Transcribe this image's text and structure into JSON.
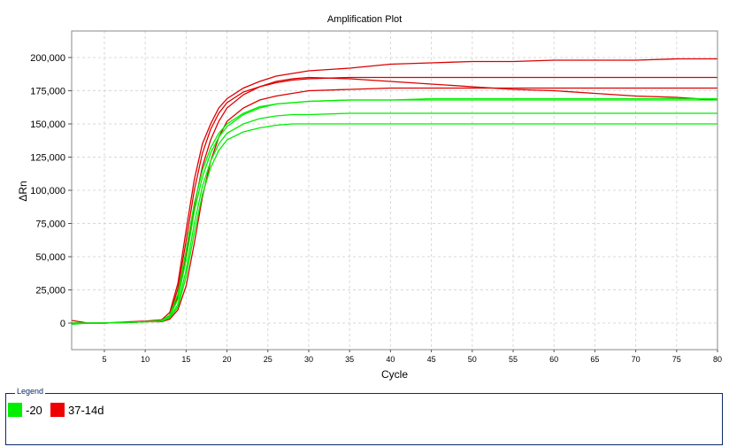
{
  "chart_data": {
    "type": "line",
    "title": "Amplification Plot",
    "xlabel": "Cycle",
    "ylabel": "ΔRn",
    "xlim": [
      1,
      80
    ],
    "ylim": [
      -20000,
      220000
    ],
    "xticks": [
      5,
      10,
      15,
      20,
      25,
      30,
      35,
      40,
      45,
      50,
      55,
      60,
      65,
      70,
      75,
      80
    ],
    "yticks": [
      0,
      25000,
      50000,
      75000,
      100000,
      125000,
      150000,
      175000,
      200000
    ],
    "ytick_labels": [
      "0",
      "25,000",
      "50,000",
      "75,000",
      "100,000",
      "125,000",
      "150,000",
      "175,000",
      "200,000"
    ],
    "grid": true,
    "legend_position": "bottom",
    "series": [
      {
        "name": "37-14d",
        "color": "#dd0000",
        "points": [
          [
            1,
            2000
          ],
          [
            3,
            0
          ],
          [
            5,
            0
          ],
          [
            8,
            1000
          ],
          [
            10,
            1500
          ],
          [
            12,
            2500
          ],
          [
            13,
            8000
          ],
          [
            14,
            30000
          ],
          [
            15,
            70000
          ],
          [
            16,
            108000
          ],
          [
            17,
            135000
          ],
          [
            18,
            150000
          ],
          [
            19,
            162000
          ],
          [
            20,
            169000
          ],
          [
            22,
            177000
          ],
          [
            24,
            182000
          ],
          [
            26,
            186000
          ],
          [
            28,
            188000
          ],
          [
            30,
            190000
          ],
          [
            35,
            192000
          ],
          [
            40,
            195000
          ],
          [
            45,
            196000
          ],
          [
            50,
            197000
          ],
          [
            55,
            197000
          ],
          [
            60,
            198000
          ],
          [
            65,
            198000
          ],
          [
            70,
            198000
          ],
          [
            75,
            199000
          ],
          [
            80,
            199000
          ]
        ]
      },
      {
        "name": "37-14d",
        "color": "#dd0000",
        "points": [
          [
            1,
            -500
          ],
          [
            3,
            0
          ],
          [
            5,
            0
          ],
          [
            8,
            500
          ],
          [
            10,
            1000
          ],
          [
            12,
            1500
          ],
          [
            13,
            6000
          ],
          [
            14,
            26000
          ],
          [
            15,
            62000
          ],
          [
            16,
            100000
          ],
          [
            17,
            128000
          ],
          [
            18,
            146000
          ],
          [
            19,
            158000
          ],
          [
            20,
            166000
          ],
          [
            22,
            174000
          ],
          [
            24,
            178000
          ],
          [
            26,
            181000
          ],
          [
            28,
            183000
          ],
          [
            30,
            184000
          ],
          [
            35,
            185000
          ],
          [
            40,
            185000
          ],
          [
            45,
            185000
          ],
          [
            50,
            185000
          ],
          [
            55,
            185000
          ],
          [
            60,
            185000
          ],
          [
            65,
            185000
          ],
          [
            70,
            185000
          ],
          [
            75,
            185000
          ],
          [
            80,
            185000
          ]
        ]
      },
      {
        "name": "37-14d",
        "color": "#dd0000",
        "points": [
          [
            1,
            0
          ],
          [
            3,
            0
          ],
          [
            5,
            0
          ],
          [
            8,
            500
          ],
          [
            10,
            1000
          ],
          [
            12,
            1500
          ],
          [
            13,
            5000
          ],
          [
            14,
            20000
          ],
          [
            15,
            50000
          ],
          [
            16,
            88000
          ],
          [
            17,
            118000
          ],
          [
            18,
            138000
          ],
          [
            19,
            152000
          ],
          [
            20,
            162000
          ],
          [
            22,
            172000
          ],
          [
            24,
            178000
          ],
          [
            26,
            182000
          ],
          [
            28,
            184000
          ],
          [
            30,
            185000
          ],
          [
            35,
            184000
          ],
          [
            40,
            182000
          ],
          [
            45,
            180000
          ],
          [
            50,
            178000
          ],
          [
            55,
            176000
          ],
          [
            60,
            175000
          ],
          [
            65,
            173000
          ],
          [
            70,
            171000
          ],
          [
            75,
            170000
          ],
          [
            80,
            168000
          ]
        ]
      },
      {
        "name": "37-14d",
        "color": "#dd0000",
        "points": [
          [
            1,
            0
          ],
          [
            3,
            0
          ],
          [
            5,
            0
          ],
          [
            8,
            500
          ],
          [
            10,
            1000
          ],
          [
            12,
            1000
          ],
          [
            13,
            3000
          ],
          [
            14,
            10000
          ],
          [
            15,
            28000
          ],
          [
            16,
            60000
          ],
          [
            17,
            95000
          ],
          [
            18,
            122000
          ],
          [
            19,
            140000
          ],
          [
            20,
            152000
          ],
          [
            22,
            162000
          ],
          [
            24,
            168000
          ],
          [
            26,
            171000
          ],
          [
            28,
            173000
          ],
          [
            30,
            175000
          ],
          [
            35,
            176000
          ],
          [
            40,
            177000
          ],
          [
            45,
            177000
          ],
          [
            50,
            177000
          ],
          [
            55,
            177000
          ],
          [
            60,
            177000
          ],
          [
            65,
            177000
          ],
          [
            70,
            177000
          ],
          [
            75,
            177000
          ],
          [
            80,
            177000
          ]
        ]
      },
      {
        "name": "-20",
        "color": "#00ee00",
        "points": [
          [
            1,
            -1000
          ],
          [
            3,
            0
          ],
          [
            5,
            0
          ],
          [
            8,
            500
          ],
          [
            10,
            1000
          ],
          [
            12,
            2000
          ],
          [
            13,
            6000
          ],
          [
            14,
            22000
          ],
          [
            15,
            55000
          ],
          [
            16,
            90000
          ],
          [
            17,
            115000
          ],
          [
            18,
            132000
          ],
          [
            19,
            143000
          ],
          [
            20,
            150000
          ],
          [
            22,
            158000
          ],
          [
            24,
            163000
          ],
          [
            26,
            165000
          ],
          [
            28,
            166000
          ],
          [
            30,
            167000
          ],
          [
            35,
            168000
          ],
          [
            40,
            168000
          ],
          [
            45,
            168000
          ],
          [
            50,
            168000
          ],
          [
            55,
            168000
          ],
          [
            60,
            168000
          ],
          [
            65,
            168000
          ],
          [
            70,
            168000
          ],
          [
            75,
            168000
          ],
          [
            80,
            168000
          ]
        ]
      },
      {
        "name": "-20",
        "color": "#00ee00",
        "points": [
          [
            1,
            0
          ],
          [
            3,
            0
          ],
          [
            5,
            0
          ],
          [
            8,
            500
          ],
          [
            10,
            1000
          ],
          [
            12,
            1500
          ],
          [
            13,
            5000
          ],
          [
            14,
            18000
          ],
          [
            15,
            48000
          ],
          [
            16,
            84000
          ],
          [
            17,
            110000
          ],
          [
            18,
            128000
          ],
          [
            19,
            140000
          ],
          [
            20,
            148000
          ],
          [
            22,
            157000
          ],
          [
            24,
            162000
          ],
          [
            26,
            165000
          ],
          [
            28,
            166000
          ],
          [
            30,
            167000
          ],
          [
            35,
            168000
          ],
          [
            40,
            168000
          ],
          [
            45,
            169000
          ],
          [
            50,
            169000
          ],
          [
            55,
            169000
          ],
          [
            60,
            169000
          ],
          [
            65,
            169000
          ],
          [
            70,
            169000
          ],
          [
            75,
            169000
          ],
          [
            80,
            169000
          ]
        ]
      },
      {
        "name": "-20",
        "color": "#00ee00",
        "points": [
          [
            1,
            0
          ],
          [
            3,
            0
          ],
          [
            5,
            0
          ],
          [
            8,
            500
          ],
          [
            10,
            1000
          ],
          [
            12,
            1500
          ],
          [
            13,
            4000
          ],
          [
            14,
            14000
          ],
          [
            15,
            40000
          ],
          [
            16,
            75000
          ],
          [
            17,
            103000
          ],
          [
            18,
            122000
          ],
          [
            19,
            135000
          ],
          [
            20,
            143000
          ],
          [
            22,
            150000
          ],
          [
            24,
            154000
          ],
          [
            26,
            156000
          ],
          [
            28,
            157000
          ],
          [
            30,
            157000
          ],
          [
            35,
            158000
          ],
          [
            40,
            158000
          ],
          [
            45,
            158000
          ],
          [
            50,
            158000
          ],
          [
            55,
            158000
          ],
          [
            60,
            158000
          ],
          [
            65,
            158000
          ],
          [
            70,
            158000
          ],
          [
            75,
            158000
          ],
          [
            80,
            158000
          ]
        ]
      },
      {
        "name": "-20",
        "color": "#00ee00",
        "points": [
          [
            1,
            0
          ],
          [
            3,
            0
          ],
          [
            5,
            0
          ],
          [
            8,
            500
          ],
          [
            10,
            1000
          ],
          [
            12,
            1500
          ],
          [
            13,
            4000
          ],
          [
            14,
            12000
          ],
          [
            15,
            35000
          ],
          [
            16,
            68000
          ],
          [
            17,
            97000
          ],
          [
            18,
            117000
          ],
          [
            19,
            130000
          ],
          [
            20,
            138000
          ],
          [
            22,
            144000
          ],
          [
            24,
            147000
          ],
          [
            26,
            149000
          ],
          [
            28,
            150000
          ],
          [
            30,
            150000
          ],
          [
            35,
            150000
          ],
          [
            40,
            150000
          ],
          [
            45,
            150000
          ],
          [
            50,
            150000
          ],
          [
            55,
            150000
          ],
          [
            60,
            150000
          ],
          [
            65,
            150000
          ],
          [
            70,
            150000
          ],
          [
            75,
            150000
          ],
          [
            80,
            150000
          ]
        ]
      }
    ]
  },
  "legend": {
    "title": "Legend",
    "items": [
      {
        "label": "-20",
        "color": "#00ee00"
      },
      {
        "label": "37-14d",
        "color": "#ee0000"
      }
    ]
  }
}
